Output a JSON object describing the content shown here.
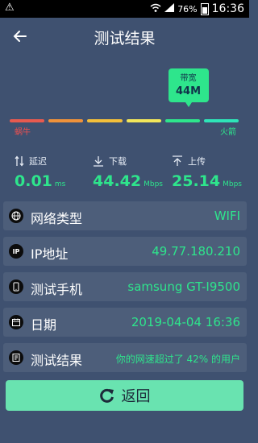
{
  "status_bar": {
    "battery": "76%",
    "time": "16:36"
  },
  "header": {
    "title": "测试结果",
    "back_icon": "arrow-left-icon"
  },
  "speed_badge": {
    "label": "带宽",
    "value": "44M"
  },
  "scale": {
    "low_label": "蜗牛",
    "high_label": "火箭",
    "segment_colors": [
      "#e85a4f",
      "#f0923a",
      "#f3bf3a",
      "#f2e65a",
      "#2ee58c",
      "#2ee5b8"
    ],
    "level_fraction": 0.78
  },
  "metrics": [
    {
      "label": "延迟",
      "icon": "latency-arrows-icon",
      "value": "0.01",
      "unit": "ms"
    },
    {
      "label": "下载",
      "icon": "download-icon",
      "value": "44.42",
      "unit": "Mbps"
    },
    {
      "label": "上传",
      "icon": "upload-icon",
      "value": "25.14",
      "unit": "Mbps"
    }
  ],
  "rows": [
    {
      "icon": "globe-icon",
      "label": "网络类型",
      "value": "WIFI"
    },
    {
      "icon": "ip-icon",
      "label": "IP地址",
      "value": "49.77.180.210"
    },
    {
      "icon": "phone-icon",
      "label": "测试手机",
      "value": "samsung GT-I9500"
    },
    {
      "icon": "calendar-icon",
      "label": "日期",
      "value": "2019-04-04 16:36"
    },
    {
      "icon": "result-list-icon",
      "label": "测试结果",
      "value": "你的网速超过了 42% 的用户"
    }
  ],
  "button": {
    "label": "返回",
    "icon": "refresh-icon"
  },
  "colors": {
    "background": "#3f5170",
    "accent": "#2ee58c",
    "row_bg": "#4d5e7a",
    "button_bg": "#69e3b0"
  }
}
